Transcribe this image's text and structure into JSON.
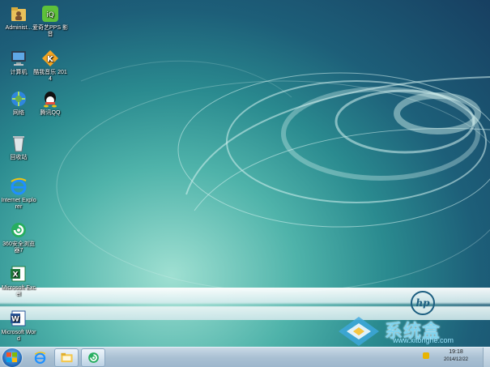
{
  "desktop_icons": [
    {
      "label": "Administ...",
      "icon": "user-folder-icon"
    },
    {
      "label": "爱奇艺PPS 影音",
      "icon": "iqiyi-pps-icon"
    },
    {
      "label": "计算机",
      "icon": "computer-icon"
    },
    {
      "label": "酷我音乐 2014",
      "icon": "kuwo-music-icon"
    },
    {
      "label": "网络",
      "icon": "network-icon"
    },
    {
      "label": "腾讯QQ",
      "icon": "qq-icon"
    },
    {
      "label": "回收站",
      "icon": "recycle-bin-icon"
    },
    {
      "label": "Internet Explorer",
      "icon": "internet-explorer-icon"
    },
    {
      "label": "360安全浏览器7",
      "icon": "360-browser-icon"
    },
    {
      "label": "Microsoft Excel",
      "icon": "excel-icon"
    },
    {
      "label": "Microsoft Word",
      "icon": "word-icon"
    }
  ],
  "wallpaper": {
    "brand": "hp"
  },
  "watermark": {
    "text": "系统盒",
    "url": "www.xitonghe.com"
  },
  "taskbar": {
    "pinned": [
      {
        "name": "internet-explorer",
        "icon": "internet-explorer-icon"
      },
      {
        "name": "windows-explorer",
        "icon": "folder-icon"
      },
      {
        "name": "360-browser",
        "icon": "360-browser-icon"
      }
    ],
    "clock": {
      "time": "19:18",
      "date": "2014/12/22"
    }
  },
  "colors": {
    "accent": "#1c5e80",
    "taskbar": "#a9c0d3"
  }
}
